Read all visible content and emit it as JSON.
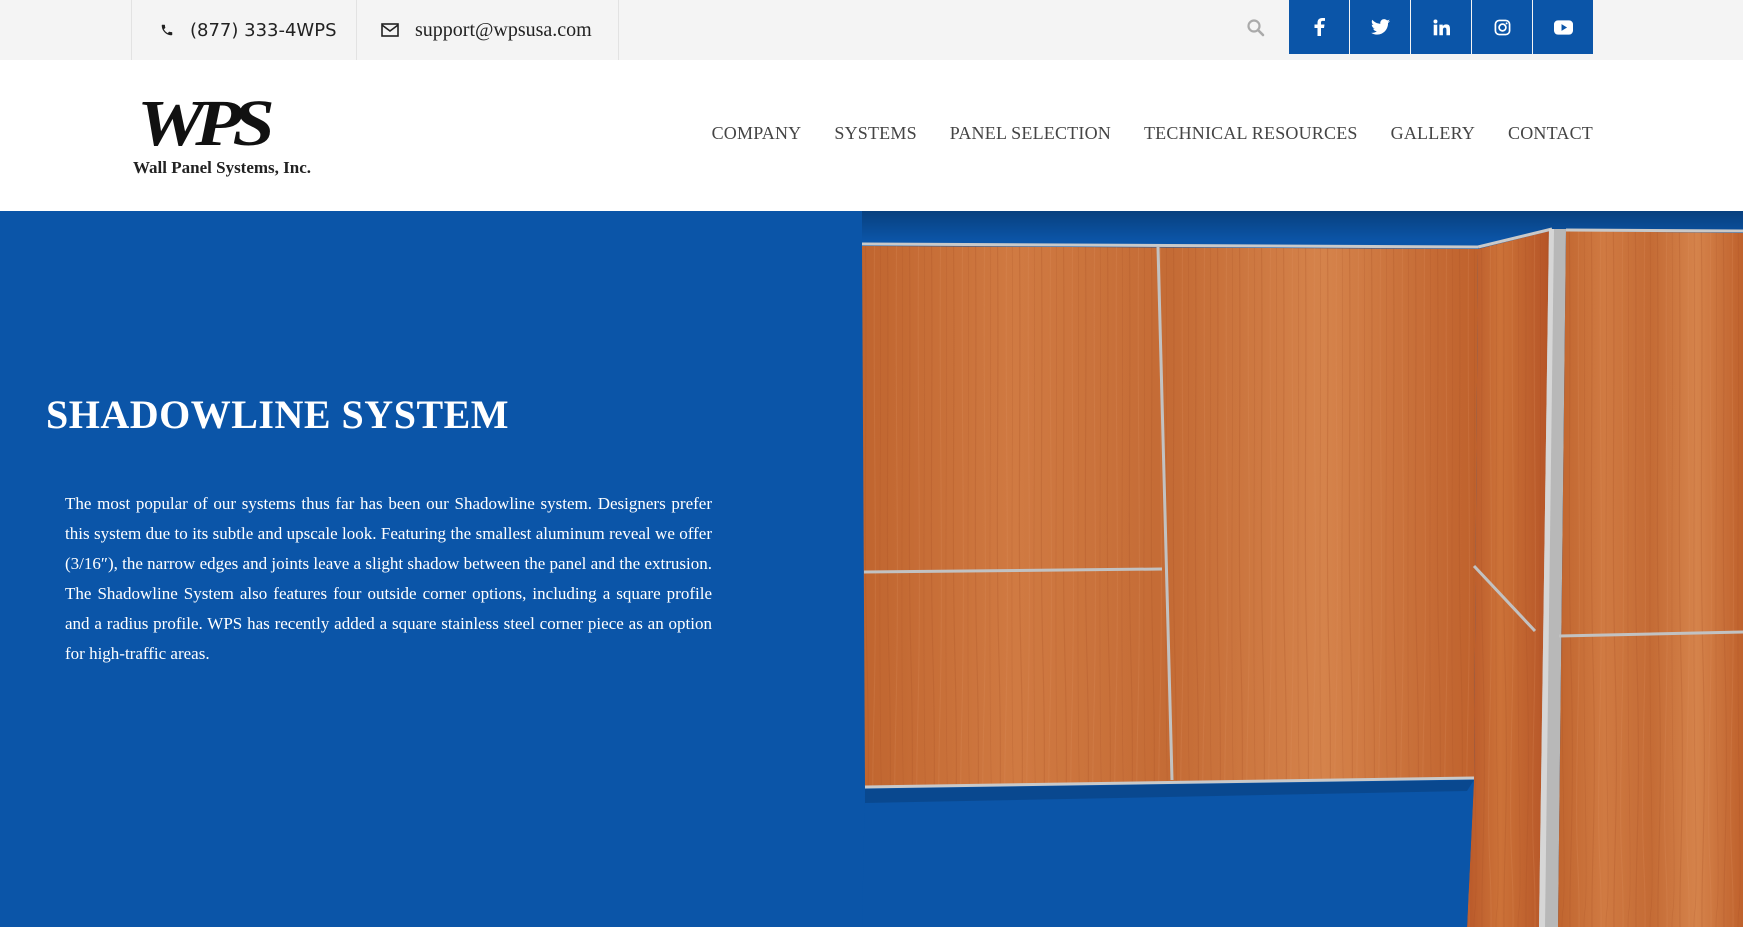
{
  "topbar": {
    "phone": "(877) 333-4WPS",
    "email": "support@wpsusa.com",
    "icons": {
      "phone": "phone-icon",
      "email": "envelope-icon",
      "search": "search-icon"
    },
    "social": [
      {
        "name": "facebook-icon",
        "glyph": "f"
      },
      {
        "name": "twitter-icon",
        "glyph": "t"
      },
      {
        "name": "linkedin-icon",
        "glyph": "in"
      },
      {
        "name": "instagram-icon",
        "glyph": "ig"
      },
      {
        "name": "youtube-icon",
        "glyph": "yt"
      }
    ]
  },
  "logo": {
    "mark": "WPS",
    "tagline": "Wall Panel Systems, Inc."
  },
  "nav": {
    "items": [
      "COMPANY",
      "SYSTEMS",
      "PANEL SELECTION",
      "TECHNICAL RESOURCES",
      "GALLERY",
      "CONTACT"
    ]
  },
  "hero": {
    "title": "SHADOWLINE SYSTEM",
    "body": "The most popular of our systems thus far has been our Shadowline system. Designers prefer this system due to its subtle and upscale look. Featuring the smallest aluminum reveal we offer (3/16″), the narrow edges and joints leave a slight shadow between the panel and the extrusion. The Shadowline System also features four outside corner options, including a square profile and a radius profile. WPS has recently added a square stainless steel corner piece as an option for high-traffic areas."
  },
  "colors": {
    "brand_blue": "#0b55a8",
    "topbar_bg": "#f4f4f4",
    "wood": "#c66a36"
  }
}
